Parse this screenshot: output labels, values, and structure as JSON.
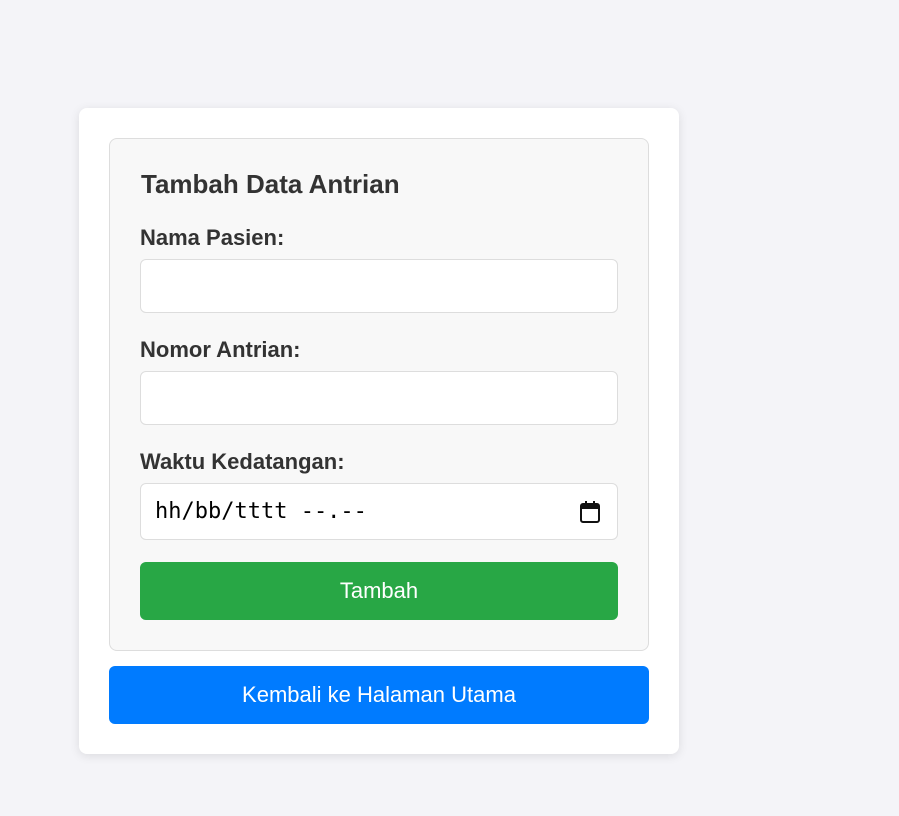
{
  "form": {
    "title": "Tambah Data Antrian",
    "nama_label": "Nama Pasien:",
    "nama_value": "",
    "nomor_label": "Nomor Antrian:",
    "nomor_value": "",
    "waktu_label": "Waktu Kedatangan:",
    "waktu_placeholder": "hh/bb/tttt --.--",
    "submit_label": "Tambah"
  },
  "back_button": {
    "label": "Kembali ke Halaman Utama"
  },
  "icons": {
    "datetime_picker": "calendar-icon"
  },
  "colors": {
    "submit": "#28a745",
    "back": "#007bff",
    "page_background": "#f4f4f8"
  }
}
